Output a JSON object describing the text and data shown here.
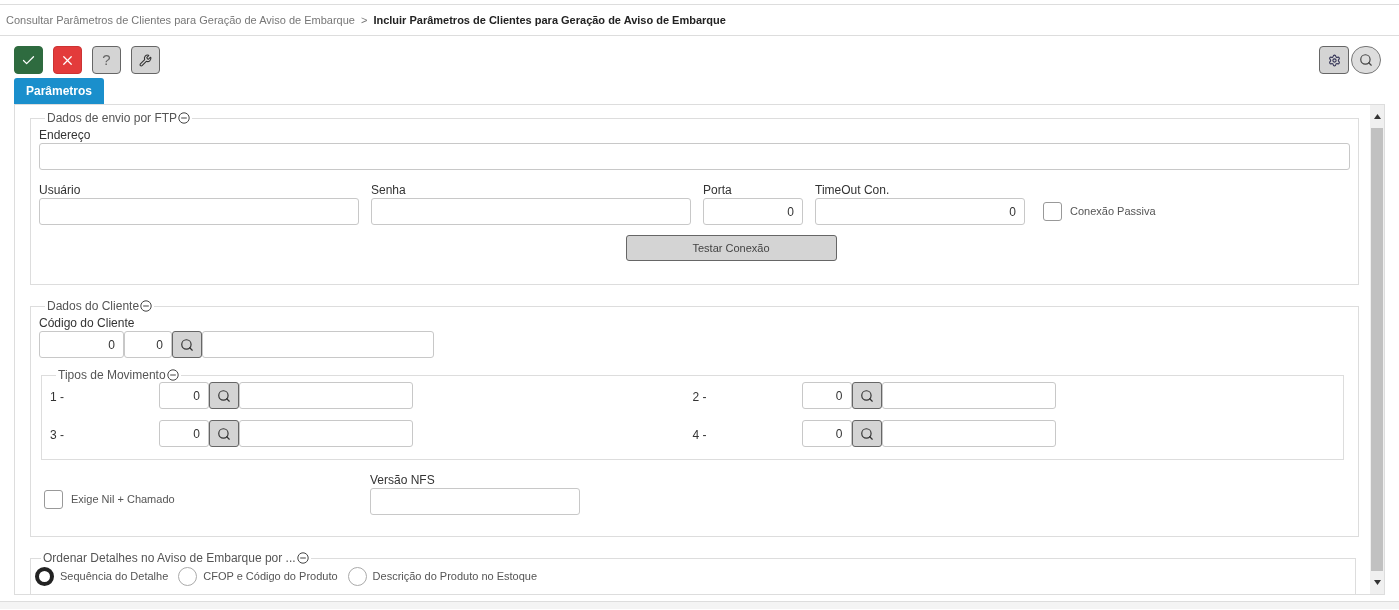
{
  "breadcrumb": {
    "parent": "Consultar Parâmetros de Clientes para Geração de Aviso de Embarque",
    "separator": ">",
    "current": "Incluir Parâmetros de Clientes para Geração de Aviso de Embarque"
  },
  "toolbar": [
    {
      "kind": "confirm"
    },
    {
      "kind": "cancel"
    },
    {
      "kind": "help",
      "glyph": "?"
    },
    {
      "kind": "tool"
    }
  ],
  "toolbar_right": [
    {
      "kind": "settings"
    },
    {
      "kind": "search"
    }
  ],
  "tabs": [
    {
      "label": "Parâmetros",
      "selected": true
    }
  ],
  "ftp": {
    "title": "Dados de envio por FTP",
    "endereco": {
      "label": "Endereço"
    },
    "row": [
      {
        "label": "Usuário"
      },
      {
        "label": "Senha"
      },
      {
        "label": "Porta",
        "value": "0"
      },
      {
        "label": "TimeOut Con.",
        "value": "0"
      }
    ],
    "passiva": {
      "label": "Conexão Passiva",
      "checked": false
    },
    "test_button": "Testar Conexão"
  },
  "cliente": {
    "title": "Dados do Cliente",
    "codigo": {
      "label": "Código do Cliente",
      "value_1": "0",
      "value_2": "0"
    },
    "tipos": {
      "title": "Tipos de Movimento",
      "rows": [
        {
          "label": "1 -",
          "value": "0"
        },
        {
          "label": "2 -",
          "value": "0"
        },
        {
          "label": "3 -",
          "value": "0"
        },
        {
          "label": "4 -",
          "value": "0"
        }
      ]
    },
    "exige": {
      "label": "Exige Nil + Chamado",
      "checked": false
    },
    "versao": {
      "label": "Versão NFS"
    }
  },
  "ordenar": {
    "title": "Ordenar Detalhes no Aviso de Embarque por ...",
    "options": [
      {
        "label": "Sequência do Detalhe",
        "selected": true
      },
      {
        "label": "CFOP e Código do Produto",
        "selected": false
      },
      {
        "label": "Descrição do Produto no Estoque",
        "selected": false
      }
    ]
  }
}
